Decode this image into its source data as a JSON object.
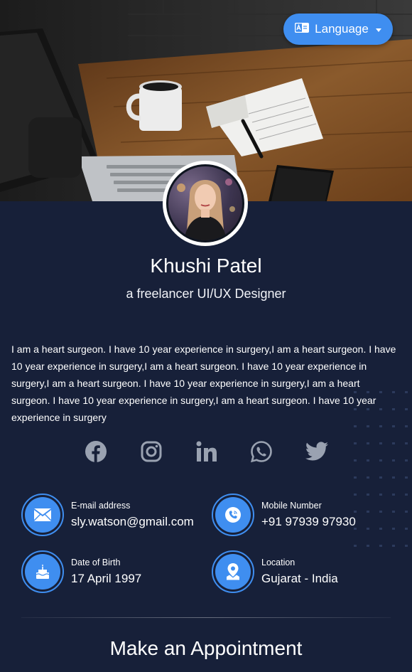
{
  "header": {
    "language_button": {
      "label": "Language",
      "icon": "language-icon",
      "color": "#3f8ef0"
    }
  },
  "profile": {
    "name": "Khushi Patel",
    "role": "a freelancer UI/UX Designer",
    "bio": "I am a heart surgeon. I have 10 year experience in surgery,I am a heart surgeon. I have 10 year experience in surgery,I am a heart surgeon. I have 10 year experience in surgery,I am a heart surgeon. I have 10 year experience in surgery,I am a heart surgeon. I have 10 year experience in surgery,I am a heart surgeon. I have 10 year experience in surgery"
  },
  "socials": [
    {
      "name": "facebook",
      "icon": "facebook-icon"
    },
    {
      "name": "instagram",
      "icon": "instagram-icon"
    },
    {
      "name": "linkedin",
      "icon": "linkedin-icon"
    },
    {
      "name": "whatsapp",
      "icon": "whatsapp-icon"
    },
    {
      "name": "twitter",
      "icon": "twitter-icon"
    }
  ],
  "contacts": {
    "email": {
      "label": "E-mail address",
      "value": "sly.watson@gmail.com",
      "icon": "envelope-icon"
    },
    "mobile": {
      "label": "Mobile Number",
      "value": "+91 97939 97930",
      "icon": "phone-icon"
    },
    "dob": {
      "label": "Date of Birth",
      "value": "17 April 1997",
      "icon": "birthday-cake-icon"
    },
    "location": {
      "label": "Location",
      "value": "Gujarat - India",
      "icon": "map-pin-icon"
    }
  },
  "appointment": {
    "title": "Make an Appointment"
  },
  "colors": {
    "accent": "#3f8ef0",
    "background": "#172039",
    "social_icon": "#9aa2b1"
  }
}
